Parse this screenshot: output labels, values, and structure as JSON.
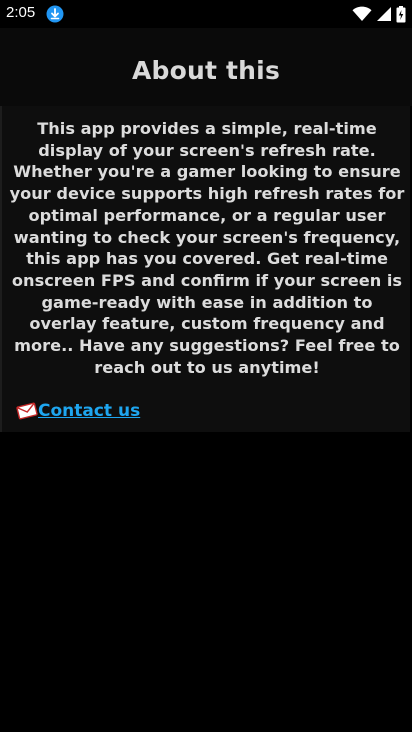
{
  "status_bar": {
    "time": "2:05",
    "icons": [
      "download-icon",
      "wifi-icon",
      "signal-icon",
      "battery-icon"
    ]
  },
  "page": {
    "title": "About this",
    "description": "This app provides a simple, real-time display of your screen's refresh rate. Whether you're a gamer looking to ensure your device supports high refresh rates for optimal performance, or a regular user wanting to check your screen's frequency, this app has you covered. Get real-time onscreen FPS and confirm if your screen is game-ready with ease in addition to overlay feature, custom frequency and more.. Have any suggestions? Feel free to reach out to us anytime!"
  },
  "contact": {
    "label": "Contact us",
    "icon": "mail-icon"
  },
  "colors": {
    "background": "#000000",
    "title": "#d9d9d9",
    "text": "#dcdcdc",
    "link": "#1ea6f0",
    "status_download": "#2196f3"
  }
}
